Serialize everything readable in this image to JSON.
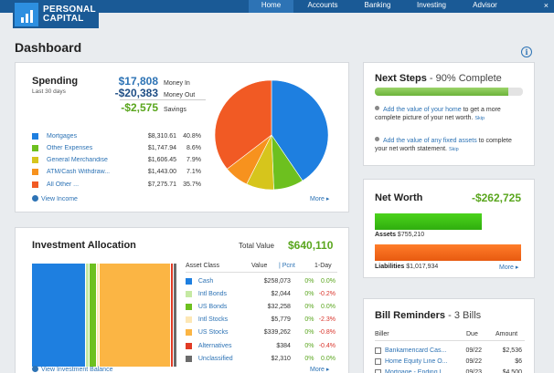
{
  "brand": {
    "name_line1": "PERSONAL",
    "name_line2": "CAPITAL"
  },
  "nav": {
    "items": [
      "Home",
      "Accounts",
      "Banking",
      "Investing",
      "Advisor"
    ],
    "active": "Home",
    "close": "×"
  },
  "page": {
    "title": "Dashboard",
    "info": "i"
  },
  "spending": {
    "title": "Spending",
    "period": "Last 30 days",
    "money_in": {
      "value": "$17,808",
      "label": "Money In"
    },
    "money_out": {
      "value": "-$20,383",
      "label": "Money Out"
    },
    "savings": {
      "value": "-$2,575",
      "label": "Savings"
    },
    "categories": [
      {
        "name": "Mortgages",
        "amount": "$8,310.61",
        "pct": "40.8%",
        "color": "#1e7fe0"
      },
      {
        "name": "Other Expenses",
        "amount": "$1,747.94",
        "pct": "8.6%",
        "color": "#6dc01f"
      },
      {
        "name": "General Merchandise",
        "amount": "$1,606.45",
        "pct": "7.9%",
        "color": "#d6c51c"
      },
      {
        "name": "ATM/Cash Withdraw...",
        "amount": "$1,443.00",
        "pct": "7.1%",
        "color": "#f7921e"
      },
      {
        "name": "All Other ...",
        "amount": "$7,275.71",
        "pct": "35.7%",
        "color": "#f15a24"
      }
    ],
    "view_income": "View Income",
    "more": "More ▸"
  },
  "chart_data": {
    "type": "pie",
    "categories": [
      "Mortgages",
      "Other Expenses",
      "General Merchandise",
      "ATM/Cash Withdraw...",
      "All Other ..."
    ],
    "values": [
      40.8,
      8.6,
      7.9,
      7.1,
      35.7
    ],
    "colors": [
      "#1e7fe0",
      "#6dc01f",
      "#d6c51c",
      "#f7921e",
      "#f15a24"
    ]
  },
  "next_steps": {
    "title": "Next Steps",
    "subtitle": "- 90% Complete",
    "progress": 0.9,
    "steps": [
      {
        "link": "Add the value of your home",
        "text": " to get a more complete picture of your net worth.",
        "skip": "Skip"
      },
      {
        "link": "Add the value of any fixed assets",
        "text": " to complete your net worth statement.",
        "skip": "Skip"
      }
    ]
  },
  "net_worth": {
    "title": "Net Worth",
    "value": "-$262,725",
    "assets_label": "Assets",
    "assets_value": "$755,210",
    "liabilities_label": "Liabilities",
    "liabilities_value": "$1,017,934",
    "more": "More ▸"
  },
  "investment": {
    "title": "Investment Allocation",
    "total_label": "Total Value",
    "total_value": "$640,110",
    "headers": {
      "asset_class": "Asset Class",
      "value": "Value",
      "pcnt": "Pcnt",
      "day": "1-Day"
    },
    "rows": [
      {
        "name": "Cash",
        "value": "$258,073",
        "pct": "0%",
        "day": "0.0%",
        "color": "#1e7fe0",
        "day_color": "#5aa61e"
      },
      {
        "name": "Intl Bonds",
        "value": "$2,044",
        "pct": "0%",
        "day": "-0.2%",
        "color": "#c5e9a3",
        "day_color": "#d9342b"
      },
      {
        "name": "US Bonds",
        "value": "$32,258",
        "pct": "0%",
        "day": "0.0%",
        "color": "#6dc01f",
        "day_color": "#5aa61e"
      },
      {
        "name": "Intl Stocks",
        "value": "$5,779",
        "pct": "0%",
        "day": "-2.3%",
        "color": "#fde7b5",
        "day_color": "#d9342b"
      },
      {
        "name": "US Stocks",
        "value": "$339,262",
        "pct": "0%",
        "day": "-0.8%",
        "color": "#fbb544",
        "day_color": "#d9342b"
      },
      {
        "name": "Alternatives",
        "value": "$384",
        "pct": "0%",
        "day": "-0.4%",
        "color": "#e13b25",
        "day_color": "#d9342b"
      },
      {
        "name": "Unclassified",
        "value": "$2,310",
        "pct": "0%",
        "day": "0.0%",
        "color": "#6b6b6b",
        "day_color": "#5aa61e"
      }
    ],
    "view_balance": "View Investment Balance",
    "more": "More ▸"
  },
  "bills": {
    "title": "Bill Reminders",
    "subtitle": "- 3 Bills",
    "headers": {
      "biller": "Biller",
      "due": "Due",
      "amount": "Amount"
    },
    "rows": [
      {
        "name": "Bankamericard Cas...",
        "due": "09/22",
        "amount": "$2,536"
      },
      {
        "name": "Home Equity Line O...",
        "due": "09/22",
        "amount": "$6"
      },
      {
        "name": "Mortgage - Ending I...",
        "due": "09/23",
        "amount": "$4,500"
      }
    ]
  }
}
